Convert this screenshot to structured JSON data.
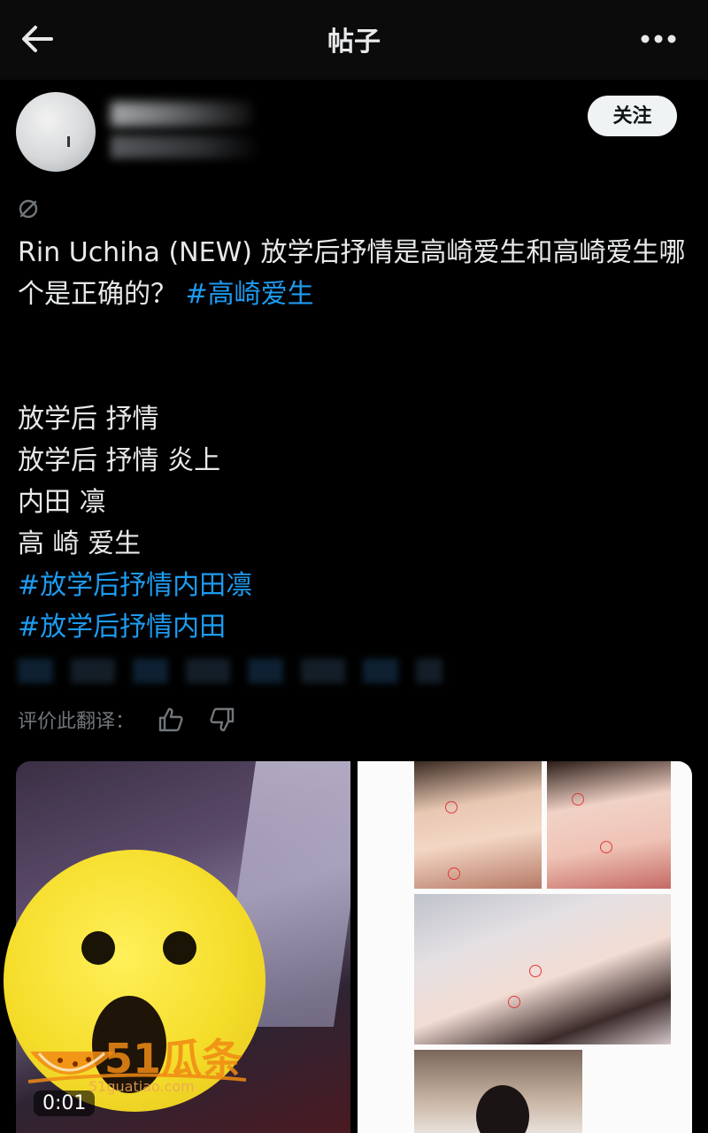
{
  "header": {
    "title": "帖子",
    "back_icon": "arrow-left-icon",
    "more_icon": "more-horizontal-icon"
  },
  "author": {
    "follow_label": "关注"
  },
  "post": {
    "paragraph1": {
      "text": "Rin Uchiha (NEW) 放学后抒情是高崎爱生和高崎爱生哪个是正确的？ ",
      "hashtag": "#高崎爱生"
    },
    "lines": [
      "放学后 抒情",
      "放学后 抒情 炎上",
      "内田 凛",
      "高 崎 爱生"
    ],
    "hashtags": [
      "#放学后抒情内田凛",
      "#放学后抒情内田"
    ]
  },
  "translation_rating": {
    "label": "评价此翻译：",
    "up_icon": "thumbs-up-icon",
    "down_icon": "thumbs-down-icon"
  },
  "media": {
    "video_time": "0:01",
    "watermark_text": "51瓜条",
    "watermark_url": "51guatiao.com"
  },
  "colors": {
    "background": "#000000",
    "link": "#1d9bf0",
    "muted": "#71767b",
    "emoji": "#f5dd2a",
    "watermark": "#f08a14"
  }
}
